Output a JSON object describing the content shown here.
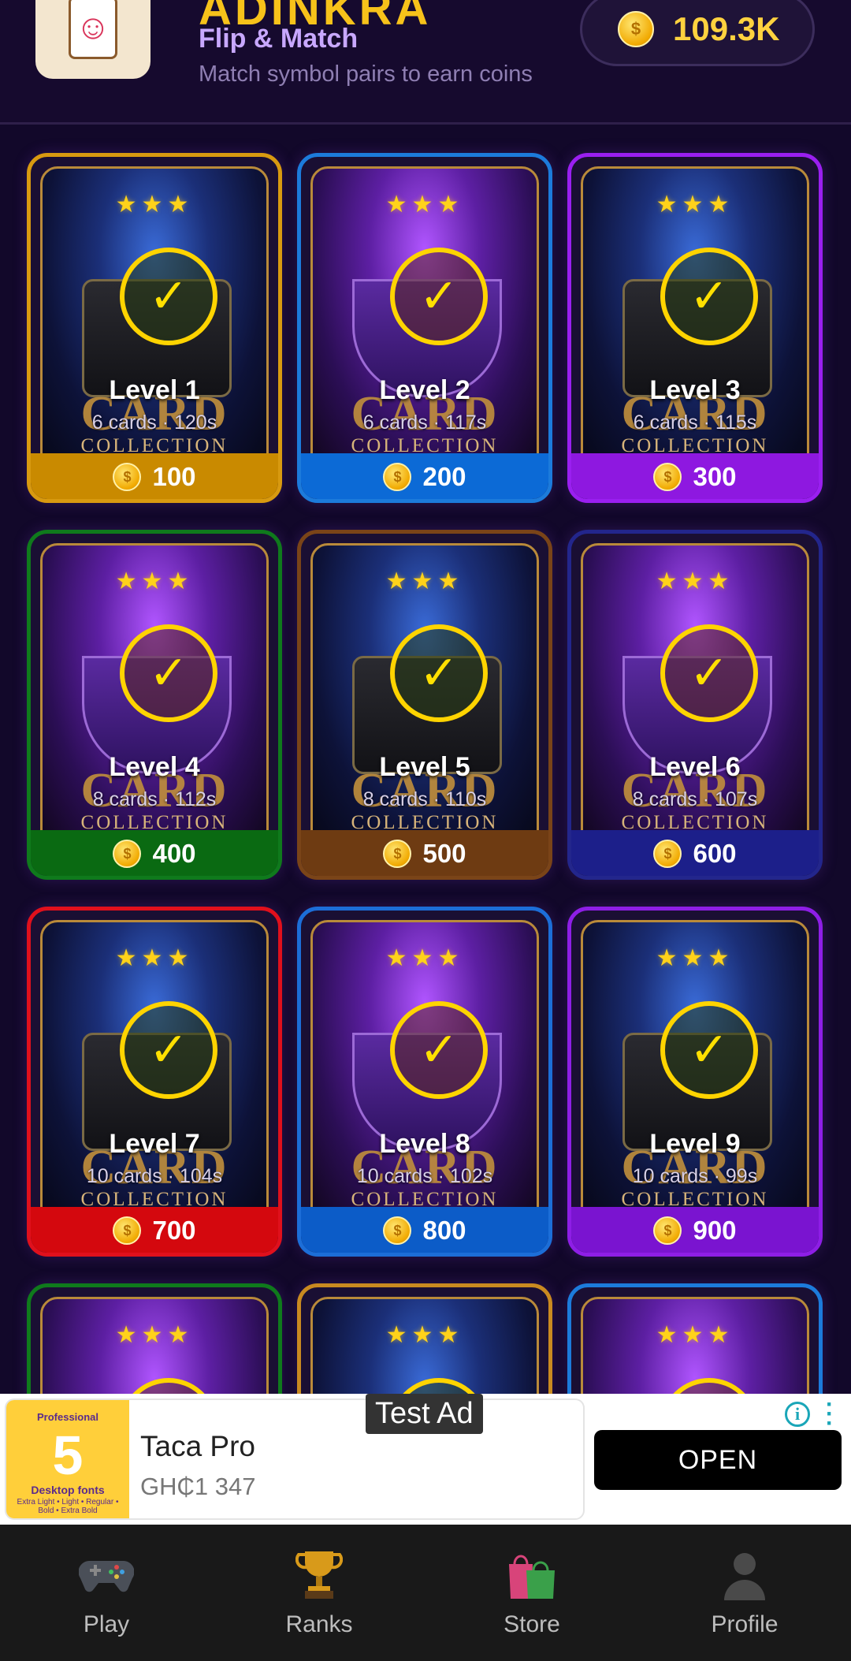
{
  "app": {
    "title": "ADINKRA",
    "subtitle": "Flip & Match",
    "tagline": "Match symbol pairs to earn coins",
    "logo_icon": "joker-card-icon"
  },
  "wallet": {
    "balance": "109.3K",
    "icon": "coin-icon"
  },
  "levels": [
    {
      "label": "Level 1",
      "meta": "6 cards · 120s",
      "reward": "100",
      "stars": "★★★",
      "art_title": "CARD",
      "art_subtitle": "COLLECTION",
      "theme": "blue",
      "border": "#d89a10",
      "bar": "#c98a00"
    },
    {
      "label": "Level 2",
      "meta": "6 cards · 117s",
      "reward": "200",
      "stars": "★★★",
      "art_title": "CARD",
      "art_subtitle": "COLLECTION",
      "theme": "purple",
      "border": "#1c7bdb",
      "bar": "#0c6ad6"
    },
    {
      "label": "Level 3",
      "meta": "6 cards · 115s",
      "reward": "300",
      "stars": "★★★",
      "art_title": "CARD",
      "art_subtitle": "COLLECTION",
      "theme": "blue",
      "border": "#9a1ff0",
      "bar": "#8e18e0"
    },
    {
      "label": "Level 4",
      "meta": "8 cards · 112s",
      "reward": "400",
      "stars": "★★★",
      "art_title": "CARD",
      "art_subtitle": "COLLECTION",
      "theme": "purple",
      "border": "#0f7a1c",
      "bar": "#0a6a12"
    },
    {
      "label": "Level 5",
      "meta": "8 cards · 110s",
      "reward": "500",
      "stars": "★★★",
      "art_title": "CARD",
      "art_subtitle": "COLLECTION",
      "theme": "blue",
      "border": "#7a4418",
      "bar": "#6e3b12"
    },
    {
      "label": "Level 6",
      "meta": "8 cards · 107s",
      "reward": "600",
      "stars": "★★★",
      "art_title": "CARD",
      "art_subtitle": "COLLECTION",
      "theme": "purple",
      "border": "#23268c",
      "bar": "#1c1f8a"
    },
    {
      "label": "Level 7",
      "meta": "10 cards · 104s",
      "reward": "700",
      "stars": "★★★",
      "art_title": "CARD",
      "art_subtitle": "COLLECTION",
      "theme": "blue",
      "border": "#e0101c",
      "bar": "#d4080e"
    },
    {
      "label": "Level 8",
      "meta": "10 cards · 102s",
      "reward": "800",
      "stars": "★★★",
      "art_title": "CARD",
      "art_subtitle": "COLLECTION",
      "theme": "purple",
      "border": "#1c6ed8",
      "bar": "#0c5cc8"
    },
    {
      "label": "Level 9",
      "meta": "10 cards · 99s",
      "reward": "900",
      "stars": "★★★",
      "art_title": "CARD",
      "art_subtitle": "COLLECTION",
      "theme": "blue",
      "border": "#8e1ee6",
      "bar": "#7a14d0"
    },
    {
      "label": "",
      "meta": "",
      "reward": "",
      "stars": "★★★",
      "art_title": "",
      "art_subtitle": "",
      "theme": "purple",
      "border": "#0f7a1c",
      "bar": "#0a6a12"
    },
    {
      "label": "",
      "meta": "",
      "reward": "",
      "stars": "★★★",
      "art_title": "",
      "art_subtitle": "",
      "theme": "blue",
      "border": "#c98a20",
      "bar": "#b07400"
    },
    {
      "label": "",
      "meta": "",
      "reward": "",
      "stars": "★★★",
      "art_title": "",
      "art_subtitle": "",
      "theme": "purple",
      "border": "#1c7bdb",
      "bar": "#0c6ad6"
    }
  ],
  "ad": {
    "tag": "Test Ad",
    "title": "Taca Pro",
    "price": "GH₵1 347",
    "cta": "OPEN",
    "thumb_top": "Professional",
    "thumb_number": "5",
    "thumb_caption": "Desktop fonts",
    "thumb_weights": "Extra Light • Light • Regular • Bold • Extra Bold",
    "info_icon": "info-icon",
    "more_icon": "more-vertical-icon"
  },
  "nav": [
    {
      "label": "Play",
      "icon": "gamepad-icon"
    },
    {
      "label": "Ranks",
      "icon": "trophy-icon"
    },
    {
      "label": "Store",
      "icon": "shopping-bags-icon"
    },
    {
      "label": "Profile",
      "icon": "user-silhouette-icon"
    }
  ]
}
